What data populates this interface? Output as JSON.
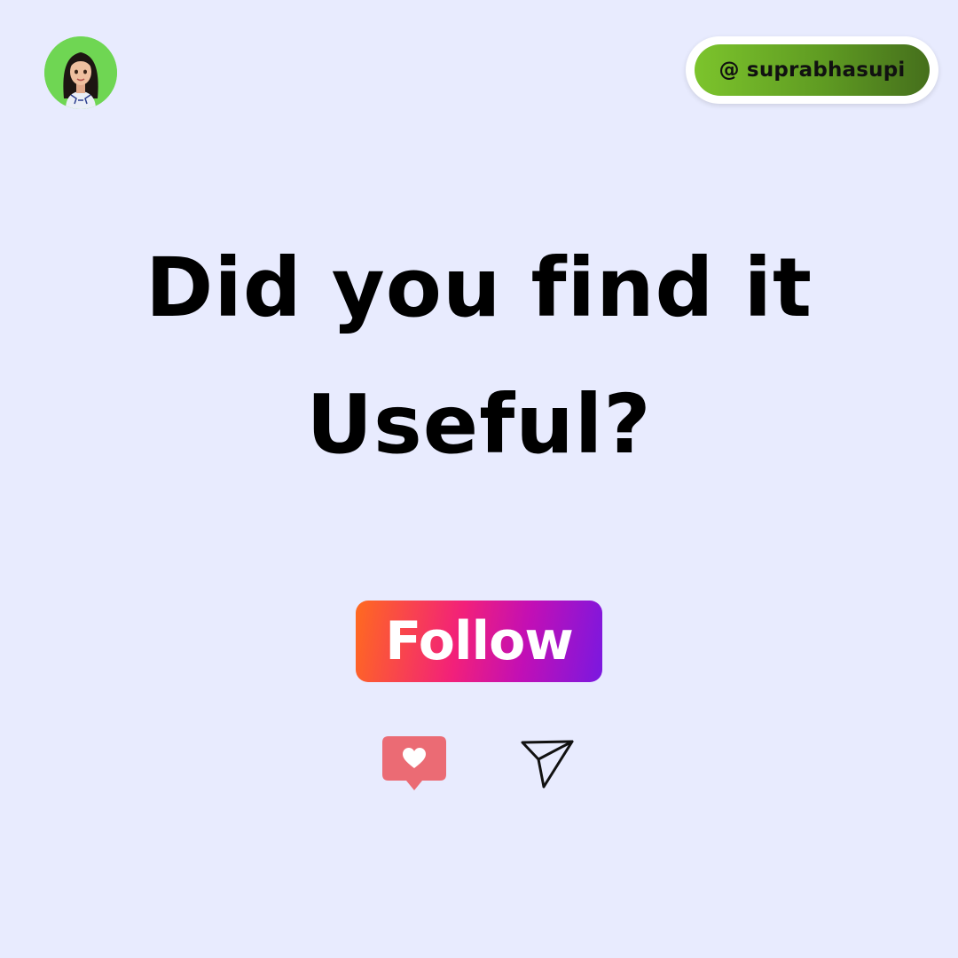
{
  "handle": {
    "text": "@ suprabhasupi"
  },
  "headline": {
    "line1": "Did you find it",
    "line2": "Useful?"
  },
  "follow_button": {
    "label": "Follow"
  },
  "icons": {
    "avatar": "avatar-icon",
    "like": "heart-notification-icon",
    "share": "paper-plane-icon"
  },
  "colors": {
    "background": "#e8ebfe",
    "avatar_bg": "#6fd653",
    "handle_green": "#5f9b22",
    "like_red": "#eb6b74"
  }
}
